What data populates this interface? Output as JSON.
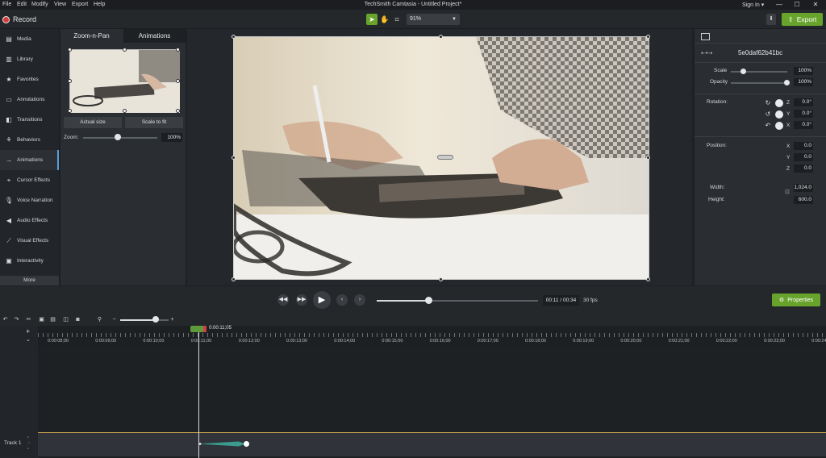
{
  "menu": [
    "File",
    "Edit",
    "Modify",
    "View",
    "Export",
    "Help"
  ],
  "window_title": "TechSmith Camtasia - Untitled Project*",
  "sign_in": "Sign In ▾",
  "window_controls": [
    "—",
    "☐",
    "✕"
  ],
  "toolbar": {
    "record_label": "Record",
    "zoom_value": "91%",
    "export_label": "Export"
  },
  "sidebar": {
    "items": [
      {
        "label": "Media",
        "icon": "media-icon"
      },
      {
        "label": "Library",
        "icon": "library-icon"
      },
      {
        "label": "Favorites",
        "icon": "star-icon"
      },
      {
        "label": "Annotations",
        "icon": "annotations-icon"
      },
      {
        "label": "Transitions",
        "icon": "transitions-icon"
      },
      {
        "label": "Behaviors",
        "icon": "behaviors-icon"
      },
      {
        "label": "Animations",
        "icon": "animations-icon"
      },
      {
        "label": "Cursor Effects",
        "icon": "cursor-icon"
      },
      {
        "label": "Voice Narration",
        "icon": "microphone-icon"
      },
      {
        "label": "Audio Effects",
        "icon": "speaker-icon"
      },
      {
        "label": "Visual Effects",
        "icon": "wand-icon"
      },
      {
        "label": "Interactivity",
        "icon": "interactivity-icon"
      }
    ],
    "more_label": "More"
  },
  "panel": {
    "tabs": [
      "Zoom-n-Pan",
      "Animations"
    ],
    "actual_size_label": "Actual size",
    "scale_to_fit_label": "Scale to fit",
    "zoom_label": "Zoom:",
    "zoom_value": "100%"
  },
  "playback": {
    "time": "00:11 / 00:34",
    "fps": "30 fps",
    "progress": 0.32,
    "properties_label": "Properties"
  },
  "properties": {
    "media_id": "5e0daf62b41bc",
    "scale_label": "Scale",
    "scale_value": "100%",
    "opacity_label": "Opacity",
    "opacity_value": "100%",
    "rotation_label": "Rotation:",
    "rotation": [
      {
        "axis": "Z",
        "value": "0.0°"
      },
      {
        "axis": "Y",
        "value": "0.0°"
      },
      {
        "axis": "X",
        "value": "0.0°"
      }
    ],
    "position_label": "Position:",
    "position": [
      {
        "axis": "X",
        "value": "0.0"
      },
      {
        "axis": "Y",
        "value": "0.0"
      },
      {
        "axis": "Z",
        "value": "0.0"
      }
    ],
    "width_label": "Width:",
    "width_value": "1,024.0",
    "height_label": "Height:",
    "height_value": "600.0"
  },
  "timeline": {
    "playhead_time": "0:00:11;05",
    "ticks": [
      "0:00:08;00",
      "0:00:09;00",
      "0:00:10;00",
      "0:00:11;00",
      "0:00:12;00",
      "0:00:13;00",
      "0:00:14;00",
      "0:00:15;00",
      "0:00:16;00",
      "0:00:17;00",
      "0:00:18;00",
      "0:00:19;00",
      "0:00:20;00",
      "0:00:21;00",
      "0:00:22;00",
      "0:00:23;00",
      "0:00:24"
    ],
    "track_label": "Track 1"
  },
  "colors": {
    "accent_green": "#68a42c",
    "record_red": "#d63a3a"
  }
}
